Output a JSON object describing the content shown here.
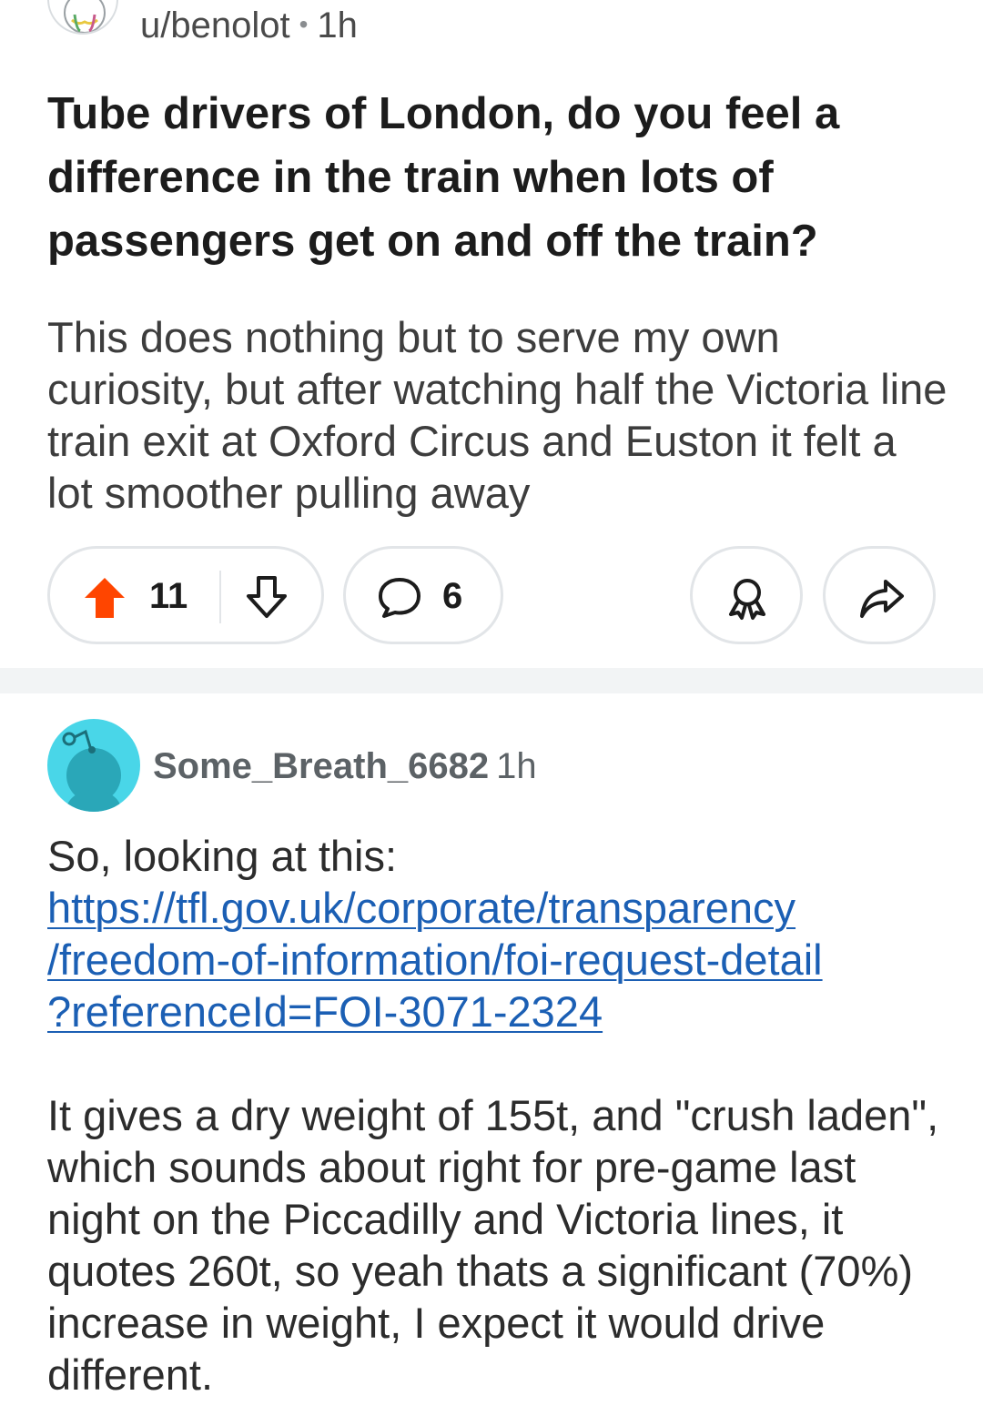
{
  "post": {
    "author": "u/benolot",
    "separator": "•",
    "age": "1h",
    "title": "Tube drivers of London, do you feel a difference in the train when lots of passengers get on and off the train?",
    "body": "This does nothing but to serve my own curiosity, but after watching half the Victoria line train exit at Oxford Circus and Euston it felt a lot smoother pulling away",
    "upvotes": "11",
    "comments": "6"
  },
  "comment": {
    "author": "Some_Breath_6682",
    "age": "1h",
    "intro": "So, looking at this:",
    "link_lines": [
      "https://tfl.gov.uk/corporate/transparency",
      "/freedom-of-information/foi-request-detail",
      "?referenceId=FOI-3071-2324"
    ],
    "paragraph": "It gives a dry weight of 155t, and \"crush laden\", which sounds about right for pre-game last night on the Piccadilly and Victoria lines, it quotes 260t, so yeah thats a significant (70%) increase in weight, I expect it would drive different."
  },
  "colors": {
    "upvote_active": "#ff4500",
    "link": "#1b5fb4",
    "avatar_bg": "#49d6e8"
  },
  "icons": {
    "upvote": "arrow-up-icon",
    "downvote": "arrow-down-icon",
    "comment": "comment-bubble-icon",
    "award": "award-icon",
    "share": "share-icon"
  }
}
